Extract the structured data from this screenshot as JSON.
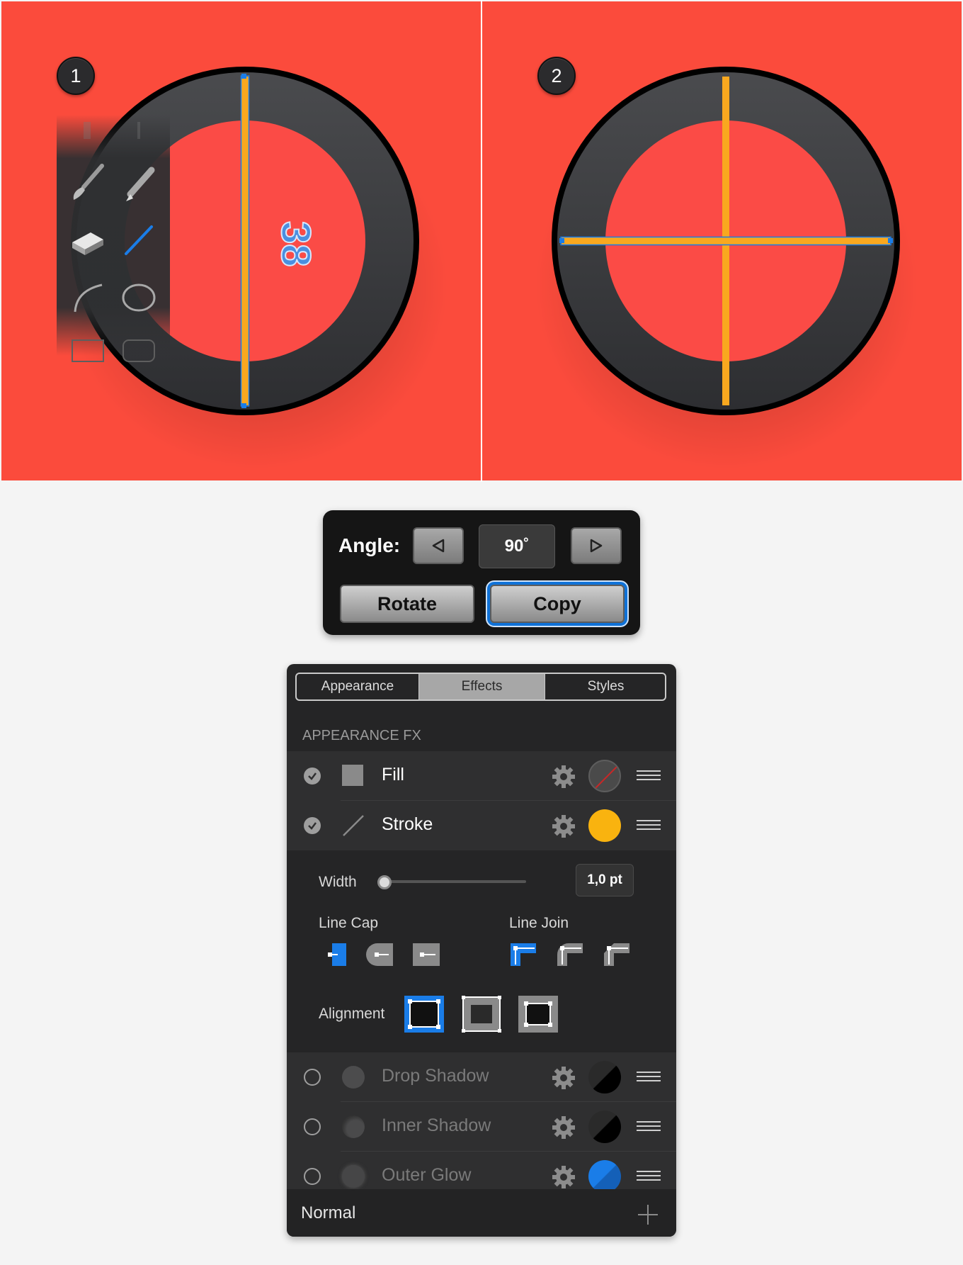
{
  "steps": {
    "first": "1",
    "second": "2"
  },
  "canvas1": {
    "overlay_text": "38",
    "stroke_color": "#f9a81f",
    "background_color": "#fb4b3c"
  },
  "canvas2": {
    "stroke_color": "#f9a81f"
  },
  "toolbox": {
    "tools": [
      "brush-tool",
      "pencil-tool",
      "eraser-tool",
      "line-tool",
      "arc-tool",
      "ellipse-tool",
      "rectangle-tool",
      "rounded-rectangle-tool"
    ]
  },
  "angle_dialog": {
    "label": "Angle:",
    "value": "90˚",
    "rotate_label": "Rotate",
    "copy_label": "Copy"
  },
  "panel": {
    "tabs": [
      "Appearance",
      "Effects",
      "Styles"
    ],
    "active_tab": "Effects",
    "section_title": "APPEARANCE FX",
    "fx": [
      {
        "label": "Fill",
        "enabled": true,
        "swatch": "none"
      },
      {
        "label": "Stroke",
        "enabled": true,
        "swatch": "#f9b30f"
      },
      {
        "label": "Drop Shadow",
        "enabled": false,
        "swatch": "#000000"
      },
      {
        "label": "Inner Shadow",
        "enabled": false,
        "swatch": "#000000"
      },
      {
        "label": "Outer Glow",
        "enabled": false,
        "swatch": "#1a7de8"
      }
    ],
    "stroke_options": {
      "width_label": "Width",
      "width_value": "1,0 pt",
      "width_slider_fraction": 0.0,
      "line_cap_label": "Line Cap",
      "line_join_label": "Line Join",
      "alignment_label": "Alignment",
      "selected_cap": "butt",
      "selected_join": "miter",
      "selected_alignment": "center"
    },
    "blend_mode": "Normal"
  },
  "colors": {
    "accent_blue": "#1a7de8",
    "selection_blue": "#0f72d8",
    "orange": "#f9a81f"
  }
}
